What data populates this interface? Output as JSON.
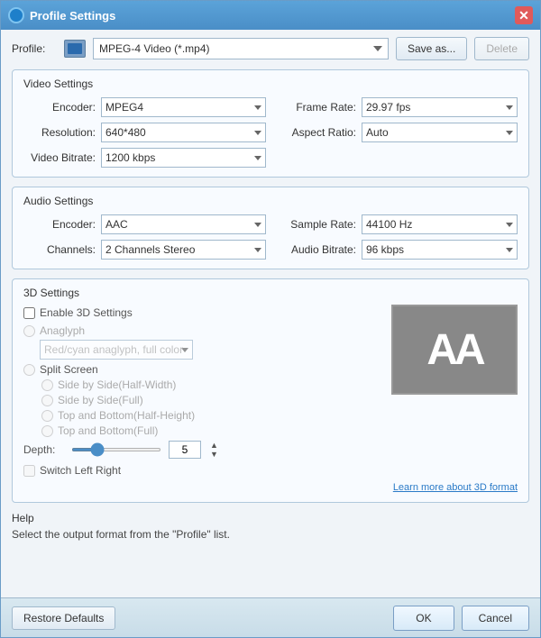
{
  "window": {
    "title": "Profile Settings",
    "close_label": "✕"
  },
  "profile": {
    "label": "Profile:",
    "value": "MPEG-4 Video (*.mp4)",
    "save_label": "Save as...",
    "delete_label": "Delete"
  },
  "video_settings": {
    "title": "Video Settings",
    "encoder_label": "Encoder:",
    "encoder_value": "MPEG4",
    "resolution_label": "Resolution:",
    "resolution_value": "640*480",
    "video_bitrate_label": "Video Bitrate:",
    "video_bitrate_value": "1200 kbps",
    "frame_rate_label": "Frame Rate:",
    "frame_rate_value": "29.97 fps",
    "aspect_ratio_label": "Aspect Ratio:",
    "aspect_ratio_value": "Auto"
  },
  "audio_settings": {
    "title": "Audio Settings",
    "encoder_label": "Encoder:",
    "encoder_value": "AAC",
    "channels_label": "Channels:",
    "channels_value": "2 Channels Stereo",
    "sample_rate_label": "Sample Rate:",
    "sample_rate_value": "44100 Hz",
    "audio_bitrate_label": "Audio Bitrate:",
    "audio_bitrate_value": "96 kbps"
  },
  "settings_3d": {
    "title": "3D Settings",
    "enable_label": "Enable 3D Settings",
    "anaglyph_label": "Anaglyph",
    "anaglyph_option": "Red/cyan anaglyph, full color",
    "split_screen_label": "Split Screen",
    "sub_options": [
      "Side by Side(Half-Width)",
      "Side by Side(Full)",
      "Top and Bottom(Half-Height)",
      "Top and Bottom(Full)"
    ],
    "depth_label": "Depth:",
    "depth_value": "5",
    "switch_label": "Switch Left Right",
    "learn_link": "Learn more about 3D format",
    "preview_text": "AA"
  },
  "help": {
    "title": "Help",
    "text": "Select the output format from the \"Profile\" list."
  },
  "footer": {
    "restore_label": "Restore Defaults",
    "ok_label": "OK",
    "cancel_label": "Cancel"
  }
}
